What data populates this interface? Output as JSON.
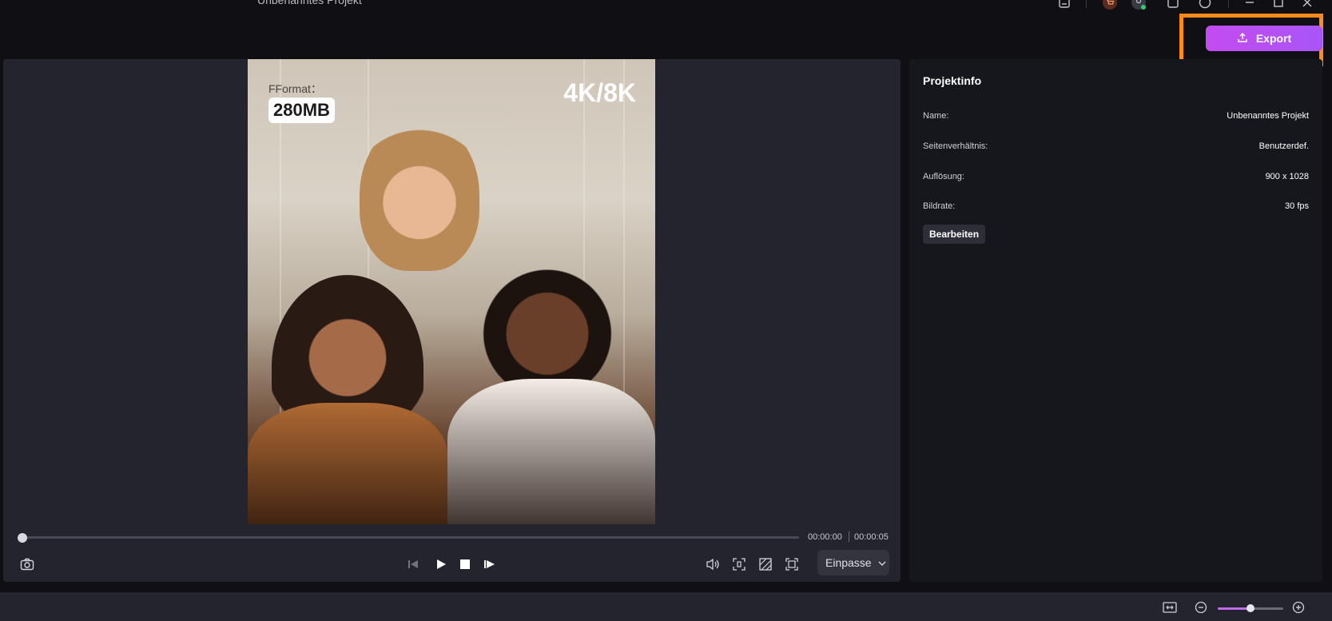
{
  "window": {
    "title": "Unbenanntes Projekt"
  },
  "toolbar": {
    "export_label": "Export"
  },
  "preview": {
    "overlay_format": "FFormat：",
    "overlay_size": "280MB",
    "overlay_resolution": "4K/8K",
    "time_current": "00:00:00",
    "time_total": "00:00:05",
    "fit_label": "Einpasse",
    "playhead_fraction": 0.0
  },
  "project_info": {
    "title": "Projektinfo",
    "rows": [
      {
        "label": "Name:",
        "value": "Unbenanntes Projekt"
      },
      {
        "label": "Seitenverhältnis:",
        "value": "Benutzerdef."
      },
      {
        "label": "Auflösung:",
        "value": "900 x 1028"
      },
      {
        "label": "Bildrate:",
        "value": "30 fps"
      }
    ],
    "edit_label": "Bearbeiten"
  },
  "timeline": {
    "zoom_fraction": 0.5
  },
  "colors": {
    "accent": "#a855f7",
    "highlight": "#ff8a1c",
    "panel": "#16161d",
    "preview_bg": "#24242f"
  }
}
